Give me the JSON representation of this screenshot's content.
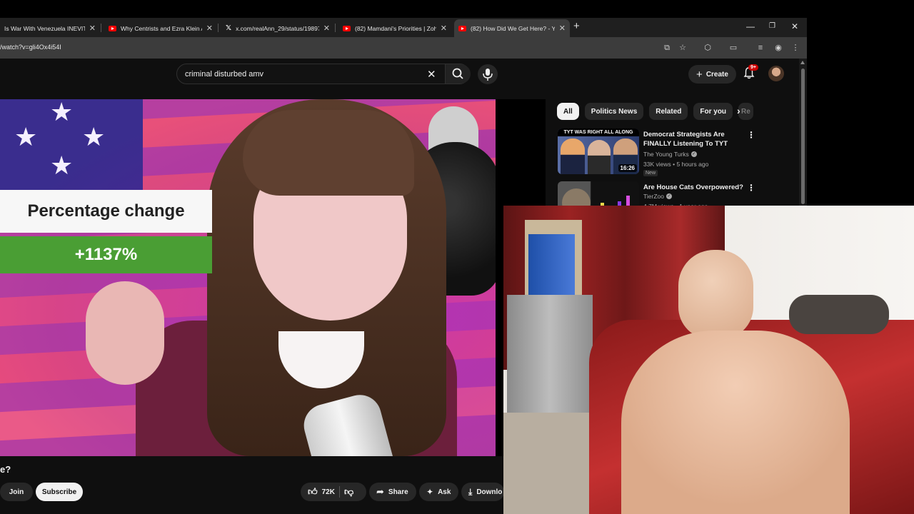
{
  "browser": {
    "tabs": [
      {
        "title": "Is War With Venezuela INEVITAB",
        "icon": "youtube-icon",
        "active": false
      },
      {
        "title": "Why Centrists and Ezra Klein Ar",
        "icon": "youtube-icon",
        "active": false
      },
      {
        "title": "x.com/realAnn_29/status/19897",
        "icon": "x-icon",
        "active": false
      },
      {
        "title": "(82) Mamdani's Priorities | Zoh",
        "icon": "youtube-icon",
        "active": false
      },
      {
        "title": "(82) How Did We Get Here? - Y",
        "icon": "youtube-icon",
        "active": true
      }
    ],
    "url": "/watch?v=gli4Ox4i54I"
  },
  "youtube": {
    "search": {
      "query": "criminal disturbed amv"
    },
    "create_label": "Create",
    "notification_count": "9+",
    "video": {
      "overlay_title": "Percentage change",
      "overlay_value": "+1137%"
    },
    "below_video": {
      "title_fragment": "e?",
      "join_label": "Join",
      "subscribe_label": "Subscribe",
      "like_count": "72K",
      "share_label": "Share",
      "ask_label": "Ask",
      "download_label": "Downlo"
    },
    "chips": [
      "All",
      "Politics News",
      "Related",
      "For you",
      "Re"
    ],
    "recommendations": [
      {
        "title": "Democrat Strategists Are FINALLY Listening To TYT",
        "channel": "The Young Turks",
        "meta": "33K views • 5 hours ago",
        "badge": "New",
        "duration": "16:26",
        "thumb_banner": "TYT WAS RIGHT ALL ALONG"
      },
      {
        "title": "Are House Cats Overpowered?",
        "channel": "TierZoo",
        "meta": "4.7M views • 1 year ago"
      }
    ]
  },
  "colors": {
    "yt_background": "#0f0f0f",
    "overlay_green": "#4a9e34",
    "accent_red": "#ff0000"
  }
}
